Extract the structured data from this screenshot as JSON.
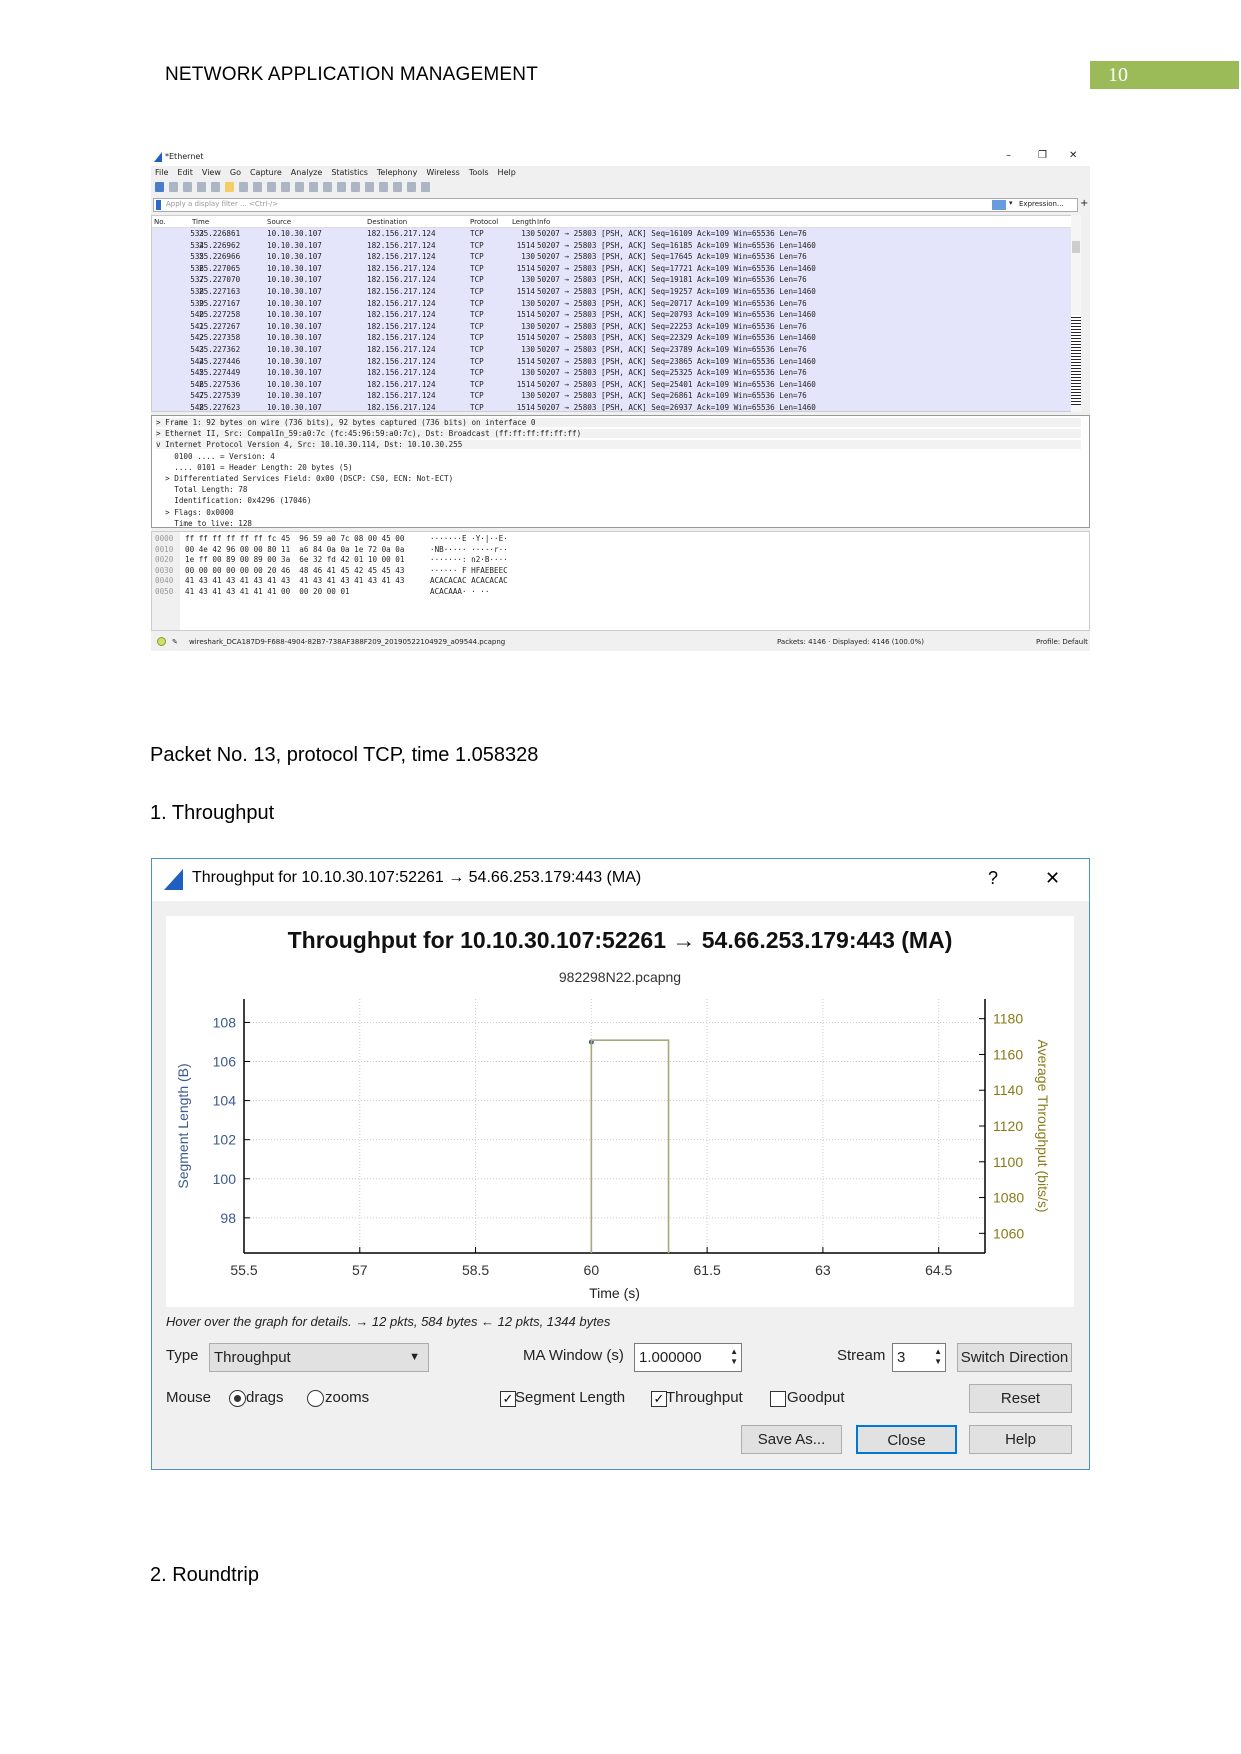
{
  "page": {
    "header": "NETWORK APPLICATION MANAGEMENT",
    "page_number": "10",
    "page_number_color": "#9bbb59",
    "caption": "Packet No. 13, protocol TCP, time 1.058328",
    "section1": "1. Throughput",
    "section2": "2. Roundtrip"
  },
  "wireshark": {
    "title": "*Ethernet",
    "window_controls": [
      "–",
      "❐",
      "✕"
    ],
    "menu": [
      "File",
      "Edit",
      "View",
      "Go",
      "Capture",
      "Analyze",
      "Statistics",
      "Telephony",
      "Wireless",
      "Tools",
      "Help"
    ],
    "filter_placeholder": "Apply a display filter ... <Ctrl-/>",
    "expression_label": "Expression...",
    "plus_label": "+",
    "columns": [
      "No.",
      "Time",
      "Source",
      "Destination",
      "Protocol",
      "Length",
      "Info"
    ],
    "rows": [
      [
        "533",
        "25.226861",
        "10.10.30.107",
        "182.156.217.124",
        "TCP",
        "130",
        "50207 → 25803 [PSH, ACK] Seq=16109 Ack=109 Win=65536 Len=76"
      ],
      [
        "534",
        "25.226962",
        "10.10.30.107",
        "182.156.217.124",
        "TCP",
        "1514",
        "50207 → 25803 [PSH, ACK] Seq=16185 Ack=109 Win=65536 Len=1460"
      ],
      [
        "535",
        "25.226966",
        "10.10.30.107",
        "182.156.217.124",
        "TCP",
        "130",
        "50207 → 25803 [PSH, ACK] Seq=17645 Ack=109 Win=65536 Len=76"
      ],
      [
        "536",
        "25.227065",
        "10.10.30.107",
        "182.156.217.124",
        "TCP",
        "1514",
        "50207 → 25803 [PSH, ACK] Seq=17721 Ack=109 Win=65536 Len=1460"
      ],
      [
        "537",
        "25.227070",
        "10.10.30.107",
        "182.156.217.124",
        "TCP",
        "130",
        "50207 → 25803 [PSH, ACK] Seq=19181 Ack=109 Win=65536 Len=76"
      ],
      [
        "538",
        "25.227163",
        "10.10.30.107",
        "182.156.217.124",
        "TCP",
        "1514",
        "50207 → 25803 [PSH, ACK] Seq=19257 Ack=109 Win=65536 Len=1460"
      ],
      [
        "539",
        "25.227167",
        "10.10.30.107",
        "182.156.217.124",
        "TCP",
        "130",
        "50207 → 25803 [PSH, ACK] Seq=20717 Ack=109 Win=65536 Len=76"
      ],
      [
        "540",
        "25.227258",
        "10.10.30.107",
        "182.156.217.124",
        "TCP",
        "1514",
        "50207 → 25803 [PSH, ACK] Seq=20793 Ack=109 Win=65536 Len=1460"
      ],
      [
        "541",
        "25.227267",
        "10.10.30.107",
        "182.156.217.124",
        "TCP",
        "130",
        "50207 → 25803 [PSH, ACK] Seq=22253 Ack=109 Win=65536 Len=76"
      ],
      [
        "542",
        "25.227358",
        "10.10.30.107",
        "182.156.217.124",
        "TCP",
        "1514",
        "50207 → 25803 [PSH, ACK] Seq=22329 Ack=109 Win=65536 Len=1460"
      ],
      [
        "543",
        "25.227362",
        "10.10.30.107",
        "182.156.217.124",
        "TCP",
        "130",
        "50207 → 25803 [PSH, ACK] Seq=23789 Ack=109 Win=65536 Len=76"
      ],
      [
        "544",
        "25.227446",
        "10.10.30.107",
        "182.156.217.124",
        "TCP",
        "1514",
        "50207 → 25803 [PSH, ACK] Seq=23865 Ack=109 Win=65536 Len=1460"
      ],
      [
        "545",
        "25.227449",
        "10.10.30.107",
        "182.156.217.124",
        "TCP",
        "130",
        "50207 → 25803 [PSH, ACK] Seq=25325 Ack=109 Win=65536 Len=76"
      ],
      [
        "546",
        "25.227536",
        "10.10.30.107",
        "182.156.217.124",
        "TCP",
        "1514",
        "50207 → 25803 [PSH, ACK] Seq=25401 Ack=109 Win=65536 Len=1460"
      ],
      [
        "547",
        "25.227539",
        "10.10.30.107",
        "182.156.217.124",
        "TCP",
        "130",
        "50207 → 25803 [PSH, ACK] Seq=26861 Ack=109 Win=65536 Len=76"
      ],
      [
        "548",
        "25.227623",
        "10.10.30.107",
        "182.156.217.124",
        "TCP",
        "1514",
        "50207 → 25803 [PSH, ACK] Seq=26937 Ack=109 Win=65536 Len=1460"
      ]
    ],
    "details": [
      "> Frame 1: 92 bytes on wire (736 bits), 92 bytes captured (736 bits) on interface 0",
      "> Ethernet II, Src: CompalIn_59:a0:7c (fc:45:96:59:a0:7c), Dst: Broadcast (ff:ff:ff:ff:ff:ff)",
      "v Internet Protocol Version 4, Src: 10.10.30.114, Dst: 10.10.30.255",
      "    0100 .... = Version: 4",
      "    .... 0101 = Header Length: 20 bytes (5)",
      "  > Differentiated Services Field: 0x00 (DSCP: CS0, ECN: Not-ECT)",
      "    Total Length: 78",
      "    Identification: 0x4296 (17046)",
      "  > Flags: 0x0000",
      "    Time to live: 128"
    ],
    "hex": [
      [
        "0000",
        "ff ff ff ff ff ff fc 45  96 59 a0 7c 08 00 45 00",
        "·······E ·Y·|··E·"
      ],
      [
        "0010",
        "00 4e 42 96 00 00 80 11  a6 84 0a 0a 1e 72 0a 0a",
        "·NB····· ·····r··"
      ],
      [
        "0020",
        "1e ff 00 89 00 89 00 3a  6e 32 fd 42 01 10 00 01",
        "·······: n2·B····"
      ],
      [
        "0030",
        "00 00 00 00 00 00 20 46  48 46 41 45 42 45 45 43",
        "······ F HFAEBEEC"
      ],
      [
        "0040",
        "41 43 41 43 41 43 41 43  41 43 41 43 41 43 41 43",
        "ACACACAC ACACACAC"
      ],
      [
        "0050",
        "41 43 41 43 41 41 41 00  00 20 00 01",
        "ACACAAA· · ··"
      ]
    ],
    "status_file": "wireshark_DCA187D9-F688-4904-82B7-738AF388F209_20190522104929_a09544.pcapng",
    "status_packets": "Packets: 4146 · Displayed: 4146 (100.0%)",
    "status_profile": "Profile: Default"
  },
  "dialog": {
    "title": "Throughput for 10.10.30.107:52261 → 54.66.253.179:443 (MA)",
    "help_label": "?",
    "close_label": "✕",
    "hover_text": "Hover over the graph for details. → 12 pkts, 584 bytes ← 12 pkts, 1344 bytes",
    "type_label": "Type",
    "type_value": "Throughput",
    "ma_label": "MA Window (s)",
    "ma_value": "1.000000",
    "stream_label": "Stream",
    "stream_value": "3",
    "switch_label": "Switch Direction",
    "mouse_label": "Mouse",
    "drags_label": "drags",
    "zooms_label": "zooms",
    "mouse_mode": "drags",
    "segment_label": "Segment Length",
    "segment_checked": true,
    "throughput_label": "Throughput",
    "throughput_checked": true,
    "goodput_label": "Goodput",
    "goodput_checked": false,
    "reset_label": "Reset",
    "save_label": "Save As...",
    "close_button_label": "Close",
    "help_button_label": "Help"
  },
  "chart_data": {
    "type": "line",
    "title": "Throughput for 10.10.30.107:52261 → 54.66.253.179:443 (MA)",
    "subtitle": "982298N22.pcapng",
    "xlabel": "Time (s)",
    "ylabel_left": "Segment Length (B)",
    "ylabel_right": "Average Throughput (bits/s)",
    "xlim": [
      55.5,
      65.1
    ],
    "ylim_left": [
      96.2,
      109.2
    ],
    "ylim_right": [
      1049,
      1191
    ],
    "xticks": [
      "55.5",
      "57",
      "58.5",
      "60",
      "61.5",
      "63",
      "64.5"
    ],
    "yticks_left": [
      "98",
      "100",
      "102",
      "104",
      "106",
      "108"
    ],
    "yticks_right": [
      "1060",
      "1080",
      "1100",
      "1120",
      "1140",
      "1160",
      "1180"
    ],
    "grid": true,
    "series": [
      {
        "name": "Segment Length",
        "axis": "left",
        "color": "#3b5a8f",
        "points": [
          [
            60,
            107
          ]
        ]
      },
      {
        "name": "Throughput",
        "axis": "right",
        "color": "#a8a878",
        "points": [
          [
            60,
            1049
          ],
          [
            60,
            1168
          ],
          [
            61,
            1168
          ],
          [
            61,
            1049
          ]
        ]
      }
    ]
  }
}
